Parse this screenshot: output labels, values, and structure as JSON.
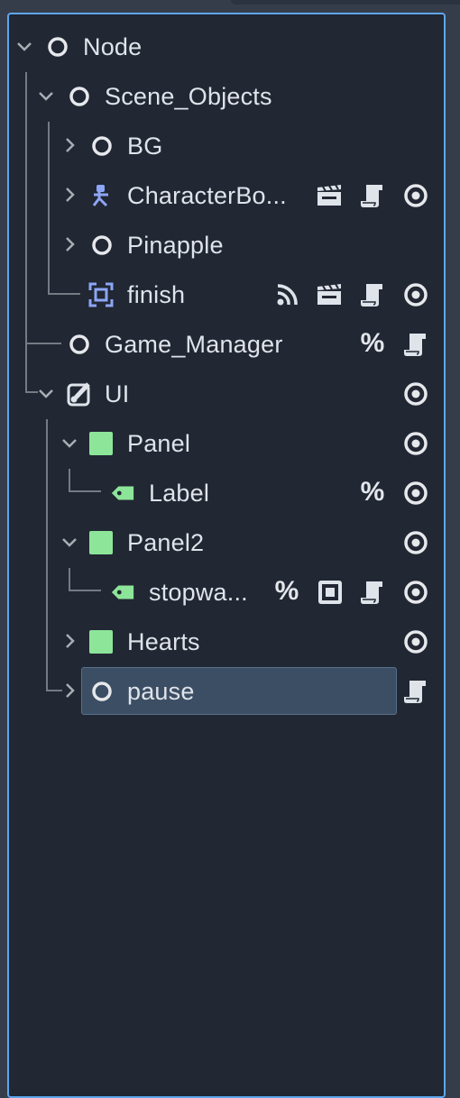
{
  "scene_tree": {
    "rows": [
      {
        "label": "Node"
      },
      {
        "label": "Scene_Objects"
      },
      {
        "label": "BG"
      },
      {
        "label": "CharacterBo..."
      },
      {
        "label": "Pinapple"
      },
      {
        "label": "finish"
      },
      {
        "label": "Game_Manager"
      },
      {
        "label": "UI"
      },
      {
        "label": "Panel"
      },
      {
        "label": "Label"
      },
      {
        "label": "Panel2"
      },
      {
        "label": "stopwa..."
      },
      {
        "label": "Hearts"
      },
      {
        "label": "pause"
      }
    ],
    "percent_symbol": "%",
    "selected_node": "pause"
  },
  "colors": {
    "panel_border": "#5ea6ee",
    "panel_bg": "#212733",
    "selection_bg": "#3b4e63",
    "control_node_green": "#8de59a",
    "character_blue": "#8da6f5",
    "area_blue": "#8da6f5"
  },
  "icons": {
    "node": "circle-node-icon",
    "character": "character-body-icon",
    "area": "area-icon",
    "control": "control-icon",
    "panel": "panel-icon",
    "label": "label-tag-icon",
    "signal": "signal-icon",
    "instance": "scene-instance-icon",
    "script": "script-icon",
    "visible": "eye-icon",
    "unique": "percent-icon",
    "toggle": "toggle-square-icon"
  }
}
